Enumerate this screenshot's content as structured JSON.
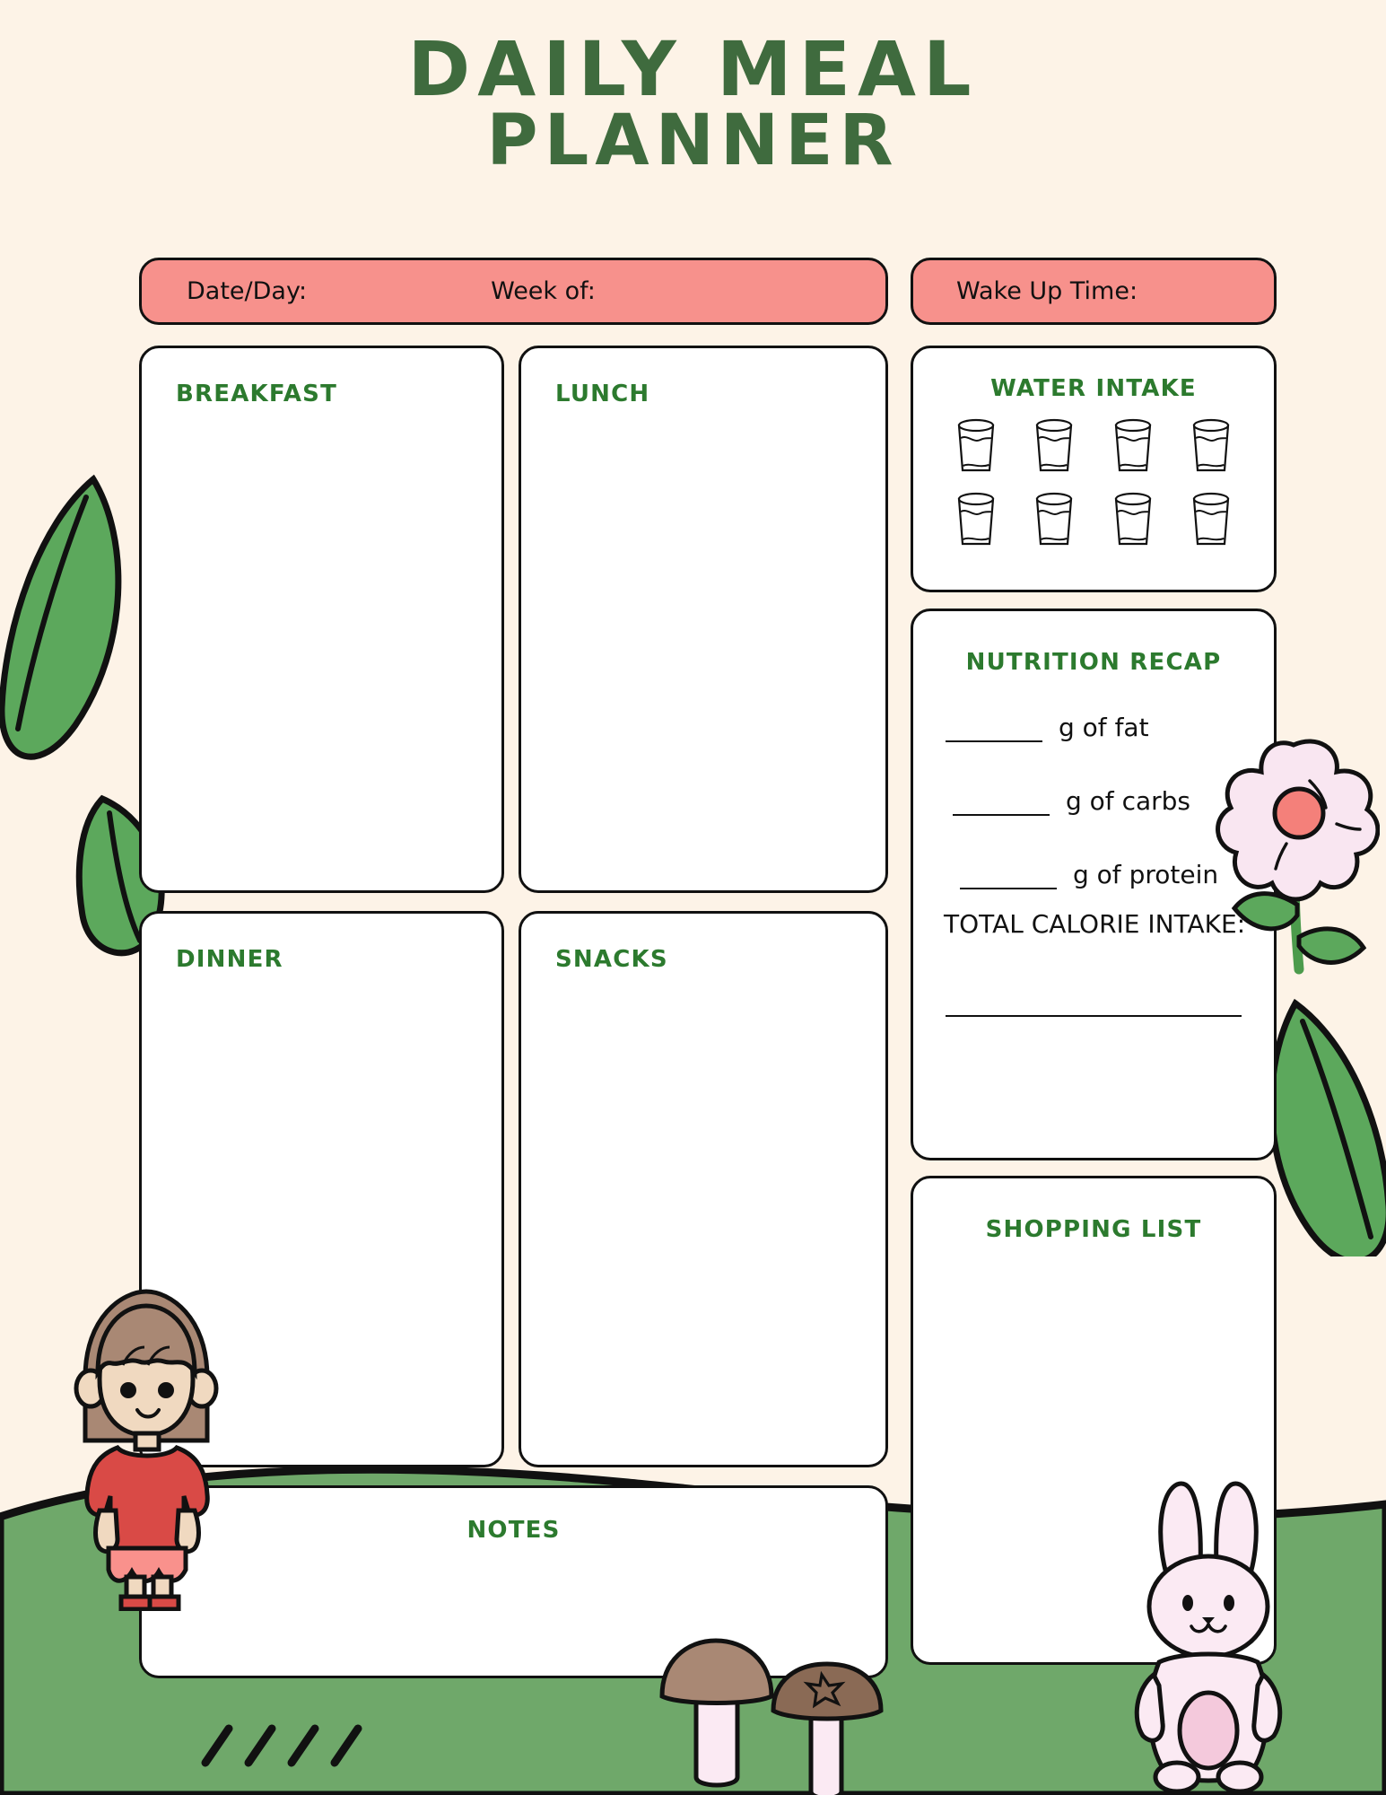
{
  "document": {
    "title_line1": "DAILY MEAL",
    "title_line2": "PLANNER",
    "background_color": "#FDF3E7",
    "accent_green": "#3F6B3E",
    "label_green": "#2C7A2E",
    "accent_pink": "#F7918C",
    "grass_green": "#6FA86A"
  },
  "header": {
    "date_day_label": "Date/Day:",
    "week_of_label": "Week of:",
    "wake_up_label": "Wake Up Time:"
  },
  "meals": {
    "breakfast_label": "BREAKFAST",
    "lunch_label": "LUNCH",
    "dinner_label": "DINNER",
    "snacks_label": "SNACKS",
    "notes_label": "NOTES"
  },
  "water": {
    "title": "WATER INTAKE",
    "glass_count": 8,
    "icon": "water-glass-icon"
  },
  "nutrition": {
    "title": "NUTRITION RECAP",
    "rows": [
      {
        "unit": "g of fat"
      },
      {
        "unit": "g of carbs"
      },
      {
        "unit": "g of protein"
      }
    ],
    "total_calorie_label": "TOTAL CALORIE INTAKE:"
  },
  "shopping": {
    "title": "SHOPPING LIST"
  },
  "decorations": [
    {
      "name": "leaf-left-large",
      "color": "#5CA85C"
    },
    {
      "name": "leaf-left-small",
      "color": "#5CA85C"
    },
    {
      "name": "leaf-right",
      "color": "#5CA85C"
    },
    {
      "name": "flower-pink",
      "petal_color": "#F9E6F1",
      "center_color": "#F4807A"
    },
    {
      "name": "girl-character",
      "hair_color": "#A98874",
      "shirt_color": "#D94A46",
      "skirt_color": "#F9918C",
      "skin_color": "#F0D9C0"
    },
    {
      "name": "bunny-character",
      "body_color": "#FBEAF3",
      "belly_color": "#F4C9DC"
    },
    {
      "name": "mushroom-left",
      "cap_color": "#A98874",
      "stem_color": "#FBEAF3"
    },
    {
      "name": "mushroom-right",
      "cap_color": "#8A6A55",
      "stem_color": "#FBEAF3"
    },
    {
      "name": "grass-strokes"
    }
  ]
}
